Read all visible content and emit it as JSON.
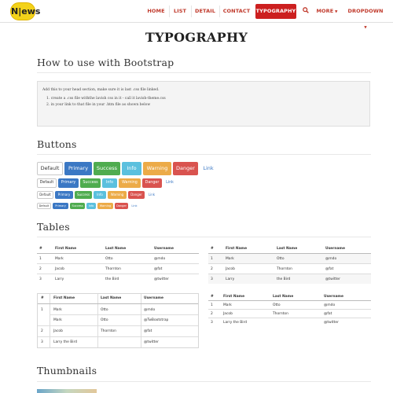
{
  "brand": {
    "logo_text": "N|ews",
    "accent": "#cc1f1f",
    "logo_color": "#f3d21a"
  },
  "nav": {
    "items": [
      "HOME",
      "LIST",
      "DETAIL",
      "CONTACT",
      "TYPOGRAPHY",
      "MORE",
      "DROPDOWN"
    ],
    "active": "TYPOGRAPHY",
    "search_icon": "search-icon"
  },
  "page_title": "TYPOGRAPHY",
  "sections": {
    "howto": {
      "title": "How to use with Bootstrap",
      "line1": "Add this to your head section, make sure it is last .css file linked.",
      "line2": "1.  create a .css file withthe lavish css in it - call it lavish-theme.css",
      "line3": "2.  in your link to that file in your .htm file as shown below"
    },
    "buttons": {
      "title": "Buttons",
      "labels": [
        "Default",
        "Primary",
        "Success",
        "Info",
        "Warning",
        "Danger",
        "Link"
      ]
    },
    "tables": {
      "title": "Tables",
      "headers": [
        "#",
        "First Name",
        "Last Name",
        "Username"
      ],
      "rows": [
        [
          "1",
          "Mark",
          "Otto",
          "@mdo"
        ],
        [
          "2",
          "Jacob",
          "Thornton",
          "@fat"
        ],
        [
          "3",
          "Larry",
          "the Bird",
          "@twitter"
        ]
      ],
      "bordered_rows": [
        [
          "1",
          "Mark",
          "Otto",
          "@mdo"
        ],
        [
          "",
          "Mark",
          "Otto",
          "@TwBootstrap"
        ],
        [
          "2",
          "Jacob",
          "Thornton",
          "@fat"
        ],
        [
          "3",
          "Larry the Bird",
          "",
          "@twitter"
        ]
      ],
      "condensed_rows": [
        [
          "1",
          "Mark",
          "Otto",
          "@mdo"
        ],
        [
          "2",
          "Jacob",
          "Thornton",
          "@fat"
        ],
        [
          "3",
          "Larry the Bird",
          "",
          "@twitter"
        ]
      ]
    },
    "thumbnails": {
      "title": "Thumbnails"
    }
  }
}
